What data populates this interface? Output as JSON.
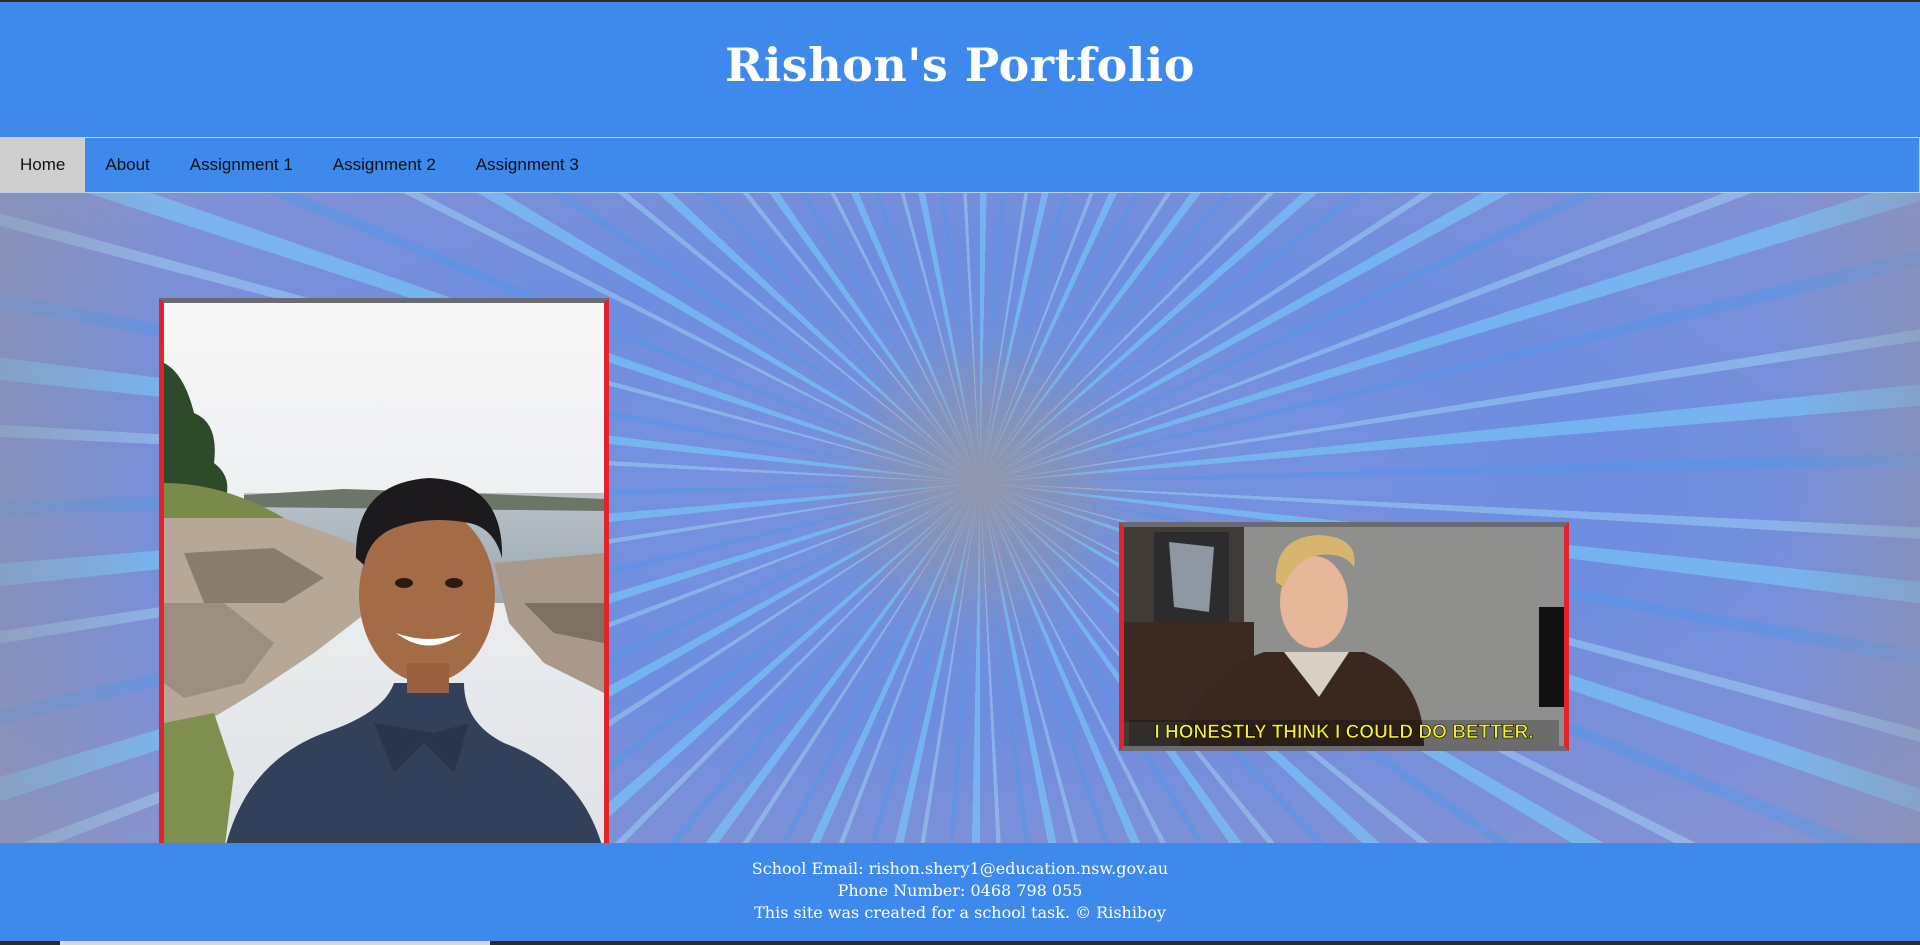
{
  "header": {
    "title": "Rishon's Portfolio"
  },
  "nav": {
    "items": [
      {
        "label": "Home",
        "active": true
      },
      {
        "label": "About",
        "active": false
      },
      {
        "label": "Assignment 1",
        "active": false
      },
      {
        "label": "Assignment 2",
        "active": false
      },
      {
        "label": "Assignment 3",
        "active": false
      }
    ]
  },
  "main": {
    "background": "hyperspace-starburst",
    "images": [
      {
        "name": "portrait-photo",
        "description": "selfie by rocky shoreline"
      },
      {
        "name": "reaction-gif",
        "caption": "I HONESTLY THINK I COULD DO BETTER."
      }
    ]
  },
  "footer": {
    "email_line": "School Email: rishon.shery1@education.nsw.gov.au",
    "phone_line": "Phone Number: 0468 798 055",
    "credit_line": "This site was created for a school task. © Rishiboy"
  },
  "colors": {
    "brand_blue": "#3d89ec",
    "active_tab": "#cfcfcf",
    "frame_red": "#e2232a",
    "frame_gray": "#6a6a70",
    "caption_yellow": "#f6ef2c"
  }
}
